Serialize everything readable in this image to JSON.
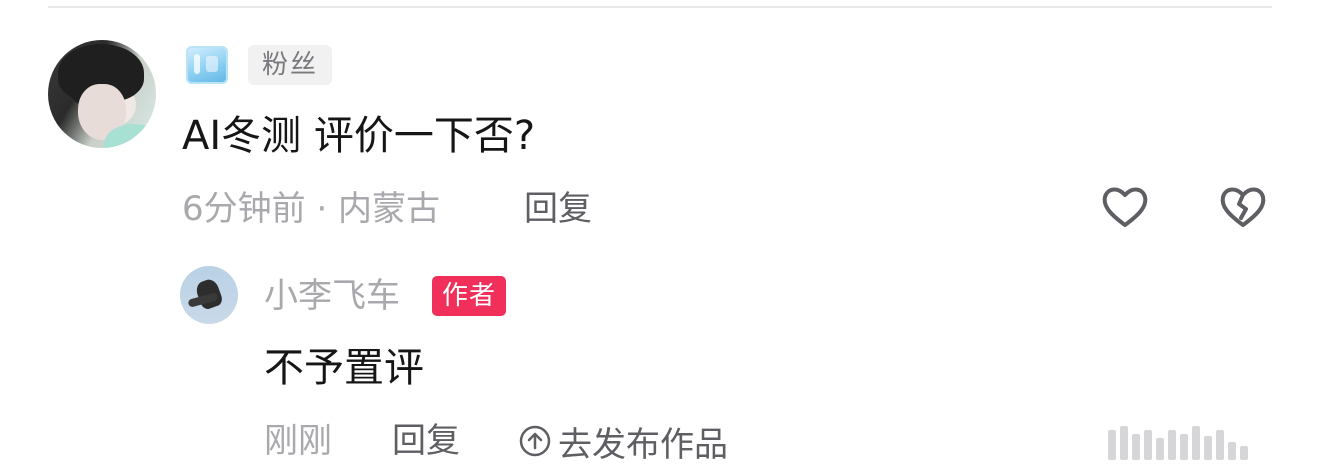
{
  "comment": {
    "fan_label": "粉丝",
    "text": "AI冬测 评价一下否?",
    "time_location": "6分钟前 · 内蒙古",
    "reply_label": "回复"
  },
  "reply": {
    "username": "小李飞车",
    "author_label": "作者",
    "text": "不予置评",
    "time": "刚刚",
    "reply_label": "回复",
    "publish_label": "去发布作品"
  },
  "icons": {
    "like": "heart-icon",
    "dislike": "broken-heart-icon",
    "publish": "circle-up-arrow-icon"
  },
  "colors": {
    "author_tag": "#f0305a",
    "meta_text": "#a9a9ad",
    "action_text": "#5f5f63"
  }
}
